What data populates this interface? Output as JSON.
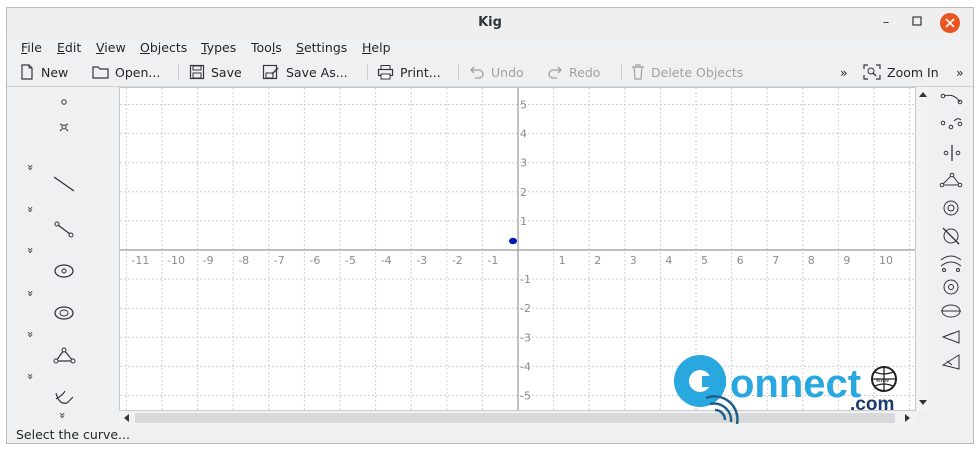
{
  "window": {
    "title": "Kig"
  },
  "menubar": {
    "items": [
      {
        "label": "File",
        "mnemonic": "F",
        "rest": "ile"
      },
      {
        "label": "Edit",
        "mnemonic": "E",
        "rest": "dit"
      },
      {
        "label": "View",
        "mnemonic": "V",
        "rest": "iew"
      },
      {
        "label": "Objects",
        "mnemonic": "O",
        "rest": "bjects"
      },
      {
        "label": "Types",
        "mnemonic": "T",
        "rest": "ypes"
      },
      {
        "label": "Tools",
        "pre": "Too",
        "mnemonic": "l",
        "rest": "s"
      },
      {
        "label": "Settings",
        "mnemonic": "S",
        "rest": "ettings"
      },
      {
        "label": "Help",
        "mnemonic": "H",
        "rest": "elp"
      }
    ]
  },
  "toolbar": {
    "new_label": "New",
    "open_label": "Open...",
    "save_label": "Save",
    "save_as_label": "Save As...",
    "print_label": "Print...",
    "undo_label": "Undo",
    "redo_label": "Redo",
    "delete_label": "Delete Objects",
    "overflow_label": "»",
    "zoom_in_label": "Zoom In",
    "overflow_right_label": "»"
  },
  "canvas": {
    "x_ticks": [
      "-11",
      "-10",
      "-9",
      "-8",
      "-7",
      "-6",
      "-5",
      "-4",
      "-3",
      "-2",
      "-1",
      "1",
      "2",
      "3",
      "4",
      "5",
      "6",
      "7",
      "8",
      "9",
      "10",
      "1"
    ],
    "y_ticks_pos": [
      "5",
      "4",
      "3",
      "2",
      "1"
    ],
    "y_ticks_neg": [
      "-1",
      "-2",
      "-3",
      "-4",
      "-5"
    ],
    "point_color": "#0019b4"
  },
  "left_toolbar": {
    "expand_label": "»",
    "icons": [
      "point-icon",
      "constrained-point-icon",
      "line-icon",
      "segment-icon",
      "circle-icon",
      "conic-icon",
      "polygon-icon",
      "transformation-icon"
    ]
  },
  "right_toolbar": {
    "icons": [
      "bezier-quadratic-icon",
      "bezier-cubic-icon",
      "vertical-line-icon",
      "triangle-icon",
      "spiral-icon",
      "no-circle-icon",
      "arcs-icon",
      "concentric-icon",
      "ellipse-icon",
      "reflection-icon",
      "similitude-icon"
    ]
  },
  "status": {
    "text": "Select the curve..."
  },
  "watermark": {
    "text": "onnect",
    "suffix": ".com",
    "globe_text": "www"
  },
  "colors": {
    "accent_close": "#e95420",
    "grid": "#cfcfcf",
    "axis": "#9a9a9a"
  }
}
